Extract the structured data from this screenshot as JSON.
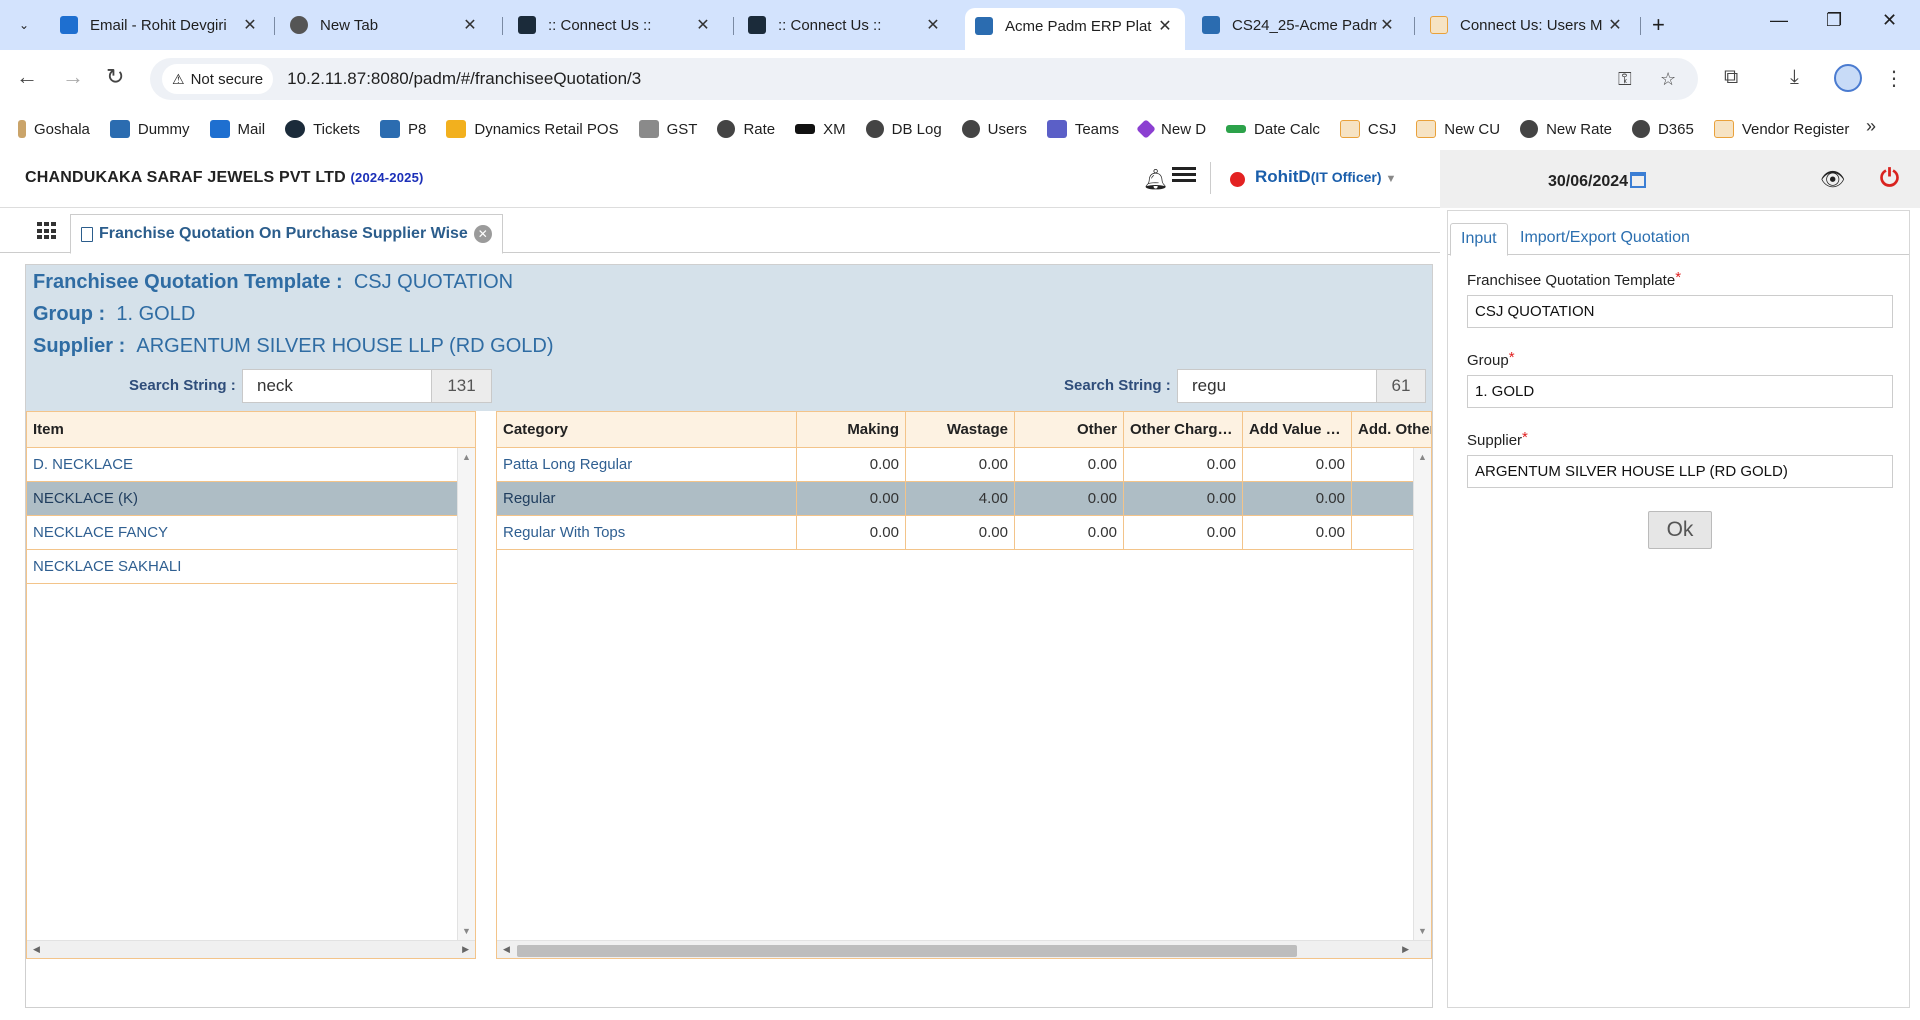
{
  "browser": {
    "tabs": [
      {
        "title": "Email - Rohit Devgiri",
        "favicon_color": "#1e6fd0",
        "active": false
      },
      {
        "title": "New Tab",
        "favicon_color": "#555555",
        "active": false
      },
      {
        "title": ":: Connect Us ::",
        "favicon_color": "#1b2b3a",
        "active": false
      },
      {
        "title": ":: Connect Us ::",
        "favicon_color": "#1b2b3a",
        "active": false
      },
      {
        "title": "Acme Padm ERP Plat",
        "favicon_color": "#2b6cb0",
        "active": true
      },
      {
        "title": "CS24_25-Acme Padm",
        "favicon_color": "#2b6cb0",
        "active": false
      },
      {
        "title": "Connect Us: Users M",
        "favicon_color": "#e9a13b",
        "active": false
      }
    ],
    "security_label": "Not secure",
    "url": "10.2.11.87:8080/padm/#/franchiseeQuotation/3",
    "bookmarks": [
      {
        "label": "Goshala",
        "color": "#caa46a"
      },
      {
        "label": "Dummy",
        "color": "#2b6cb0"
      },
      {
        "label": "Mail",
        "color": "#1e6fd0"
      },
      {
        "label": "Tickets",
        "color": "#1b2b3a"
      },
      {
        "label": "P8",
        "color": "#2b6cb0"
      },
      {
        "label": "Dynamics Retail POS",
        "color": "#f2b01e"
      },
      {
        "label": "GST",
        "color": "#8a8a8a"
      },
      {
        "label": "Rate",
        "color": "#444444"
      },
      {
        "label": "XM",
        "color": "#111111"
      },
      {
        "label": "DB Log",
        "color": "#444444"
      },
      {
        "label": "Users",
        "color": "#444444"
      },
      {
        "label": "Teams",
        "color": "#5b5fc7"
      },
      {
        "label": "New D",
        "color": "#8b3fd1"
      },
      {
        "label": "Date Calc",
        "color": "#2ca24a"
      },
      {
        "label": "CSJ",
        "color": "#e9a13b"
      },
      {
        "label": "New CU",
        "color": "#e9a13b"
      },
      {
        "label": "New Rate",
        "color": "#444444"
      },
      {
        "label": "D365",
        "color": "#444444"
      },
      {
        "label": "Vendor Register",
        "color": "#e9a13b"
      }
    ]
  },
  "header": {
    "company": "CHANDUKAKA SARAF JEWELS PVT LTD",
    "year": "(2024-2025)",
    "user_name": "RohitD",
    "user_role": "(IT Officer)",
    "date": "30/06/2024"
  },
  "page_tab": {
    "title": "Franchise Quotation On Purchase Supplier Wise"
  },
  "info": {
    "template_label": "Franchisee Quotation Template :",
    "template_value": "CSJ QUOTATION",
    "group_label": "Group :",
    "group_value": "1. GOLD",
    "supplier_label": "Supplier :",
    "supplier_value": "ARGENTUM SILVER HOUSE LLP (RD GOLD)"
  },
  "search_left": {
    "label": "Search String :",
    "value": "neck",
    "count": "131"
  },
  "search_right": {
    "label": "Search String :",
    "value": "regu",
    "count": "61"
  },
  "items_grid": {
    "header": "Item",
    "rows": [
      "D. NECKLACE",
      "NECKLACE (K)",
      "NECKLACE FANCY",
      "NECKLACE SAKHALI"
    ],
    "selected_index": 1
  },
  "category_grid": {
    "headers": [
      "Category",
      "Making",
      "Wastage",
      "Other",
      "Other Charg…",
      "Add Value …",
      "Add. Other"
    ],
    "rows": [
      [
        "Patta Long Regular",
        "0.00",
        "0.00",
        "0.00",
        "0.00",
        "0.00"
      ],
      [
        "Regular",
        "0.00",
        "4.00",
        "0.00",
        "0.00",
        "0.00"
      ],
      [
        "Regular With Tops",
        "0.00",
        "0.00",
        "0.00",
        "0.00",
        "0.00"
      ]
    ],
    "selected_index": 1
  },
  "side_panel": {
    "tab_input": "Input",
    "tab_import": "Import/Export Quotation",
    "field_template_label": "Franchisee Quotation Template",
    "field_template_value": "CSJ QUOTATION",
    "field_group_label": "Group",
    "field_group_value": "1. GOLD",
    "field_supplier_label": "Supplier",
    "field_supplier_value": "ARGENTUM SILVER HOUSE LLP (RD GOLD)",
    "ok_label": "Ok"
  }
}
